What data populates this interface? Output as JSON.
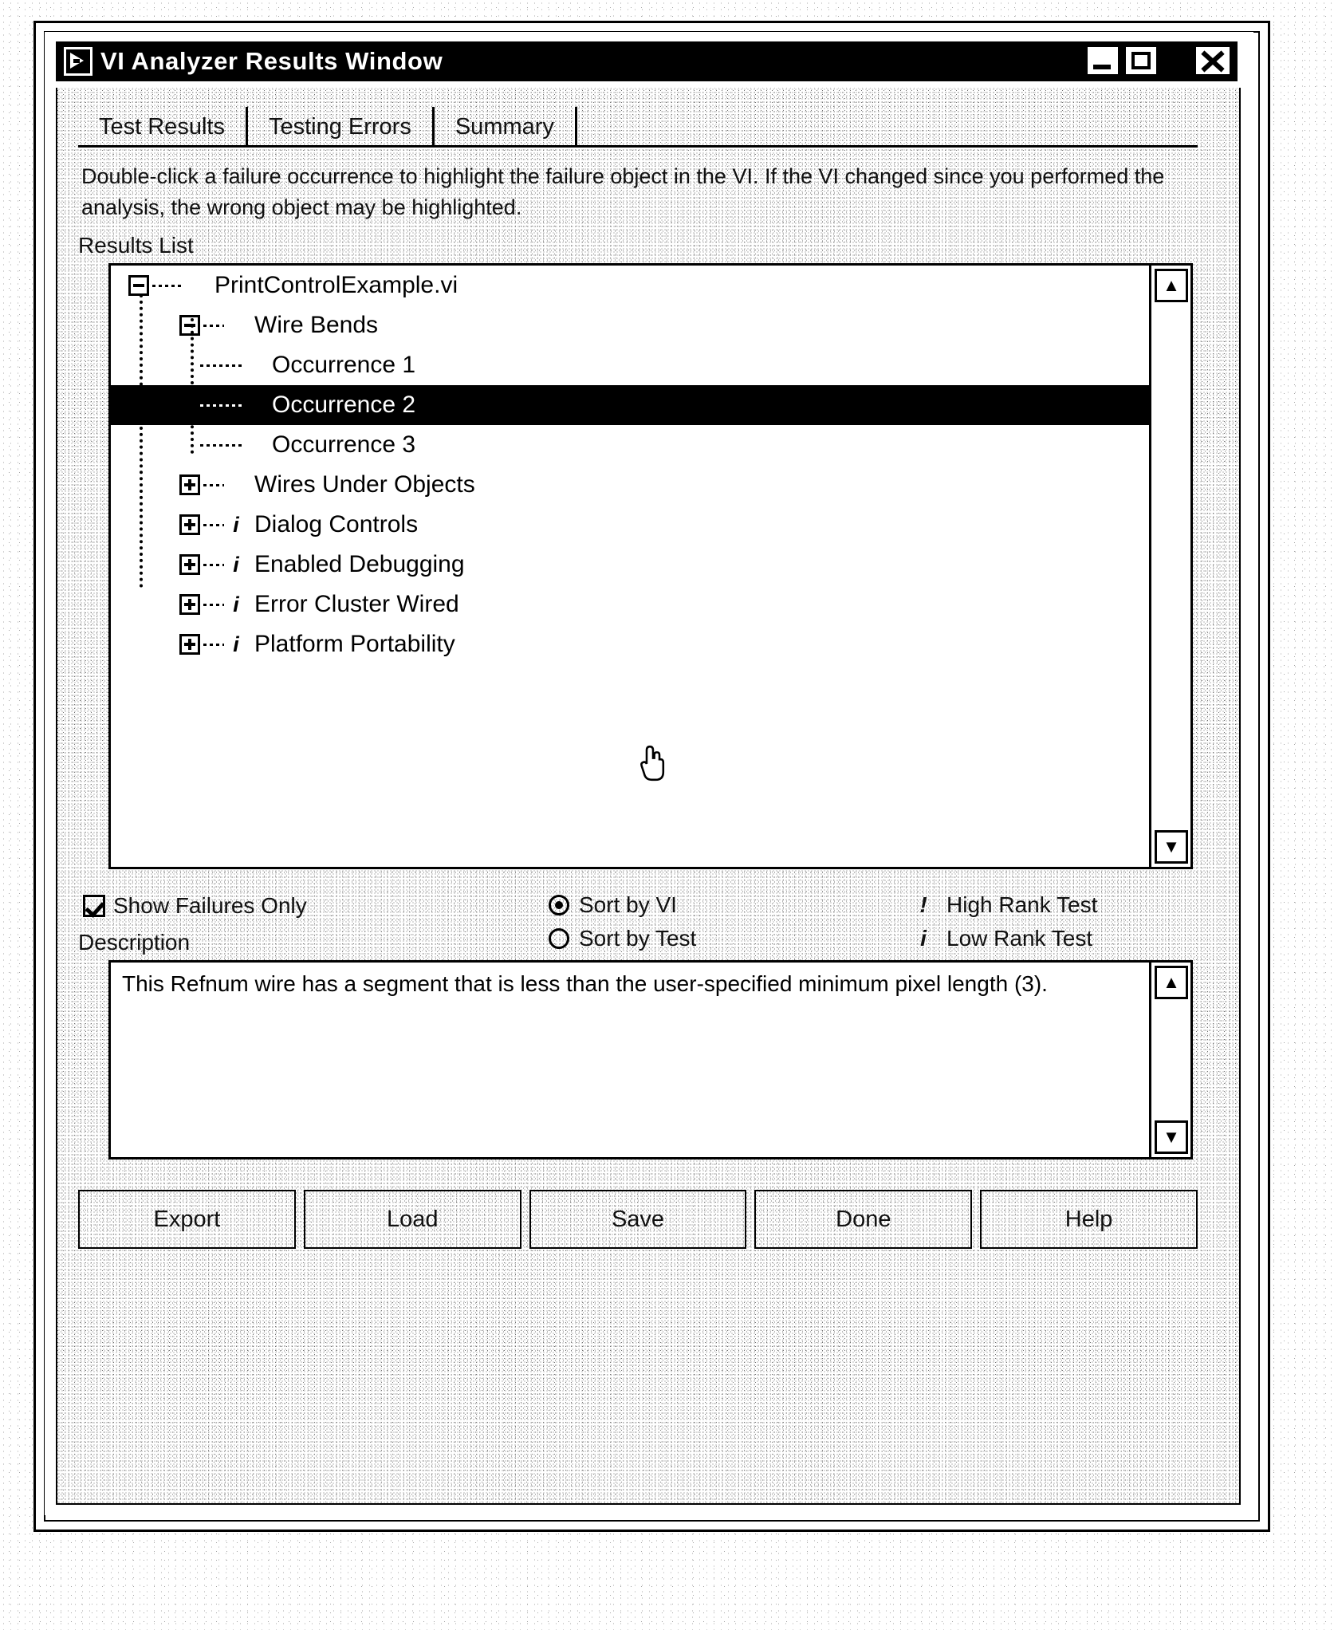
{
  "window": {
    "title": "VI Analyzer Results Window",
    "icon": "vi-analyzer-icon",
    "controls": {
      "minimize": "minimize-button",
      "maximize": "maximize-button",
      "close": "close-button"
    }
  },
  "tabs": [
    {
      "label": "Test Results",
      "active": true
    },
    {
      "label": "Testing Errors",
      "active": false
    },
    {
      "label": "Summary",
      "active": false
    }
  ],
  "instructions": "Double-click a failure occurrence to highlight the failure object in the VI. If the VI changed since you performed the analysis, the wrong object may be highlighted.",
  "results_list": {
    "label": "Results List",
    "rows": [
      {
        "label": "PrintControlExample.vi",
        "indent": 0,
        "expander": "minus",
        "rank_icon": "",
        "selected": false
      },
      {
        "label": "Wire Bends",
        "indent": 1,
        "expander": "minus",
        "rank_icon": "",
        "selected": false
      },
      {
        "label": "Occurrence 1",
        "indent": 2,
        "expander": "none",
        "rank_icon": "",
        "selected": false
      },
      {
        "label": "Occurrence 2",
        "indent": 2,
        "expander": "none",
        "rank_icon": "",
        "selected": true
      },
      {
        "label": "Occurrence 3",
        "indent": 2,
        "expander": "none",
        "rank_icon": "",
        "selected": false
      },
      {
        "label": "Wires Under Objects",
        "indent": 1,
        "expander": "plus",
        "rank_icon": "",
        "selected": false
      },
      {
        "label": "Dialog Controls",
        "indent": 1,
        "expander": "plus",
        "rank_icon": "i",
        "selected": false
      },
      {
        "label": "Enabled Debugging",
        "indent": 1,
        "expander": "plus",
        "rank_icon": "i",
        "selected": false
      },
      {
        "label": "Error Cluster Wired",
        "indent": 1,
        "expander": "plus",
        "rank_icon": "i",
        "selected": false
      },
      {
        "label": "Platform Portability",
        "indent": 1,
        "expander": "plus",
        "rank_icon": "i",
        "selected": false
      }
    ],
    "scrollbar": {
      "up_arrow": "scroll-up-arrow",
      "down_arrow": "scroll-down-arrow"
    }
  },
  "options": {
    "show_failures_only": {
      "label": "Show Failures Only",
      "checked": true
    },
    "sort": {
      "by_vi": {
        "label": "Sort by VI",
        "selected": true
      },
      "by_test": {
        "label": "Sort by Test",
        "selected": false
      }
    },
    "rank_legend": {
      "high": {
        "glyph": "!",
        "label": "High Rank Test"
      },
      "low": {
        "glyph": "i",
        "label": "Low Rank Test"
      }
    }
  },
  "description": {
    "label": "Description",
    "text": "This Refnum wire has a segment that is less than the user-specified minimum pixel length (3).",
    "scrollbar": {
      "up_arrow": "scroll-up-arrow",
      "down_arrow": "scroll-down-arrow"
    }
  },
  "buttons": [
    {
      "label": "Export"
    },
    {
      "label": "Load"
    },
    {
      "label": "Save"
    },
    {
      "label": "Done"
    },
    {
      "label": "Help"
    }
  ],
  "cursor": {
    "type": "pointing-hand"
  }
}
